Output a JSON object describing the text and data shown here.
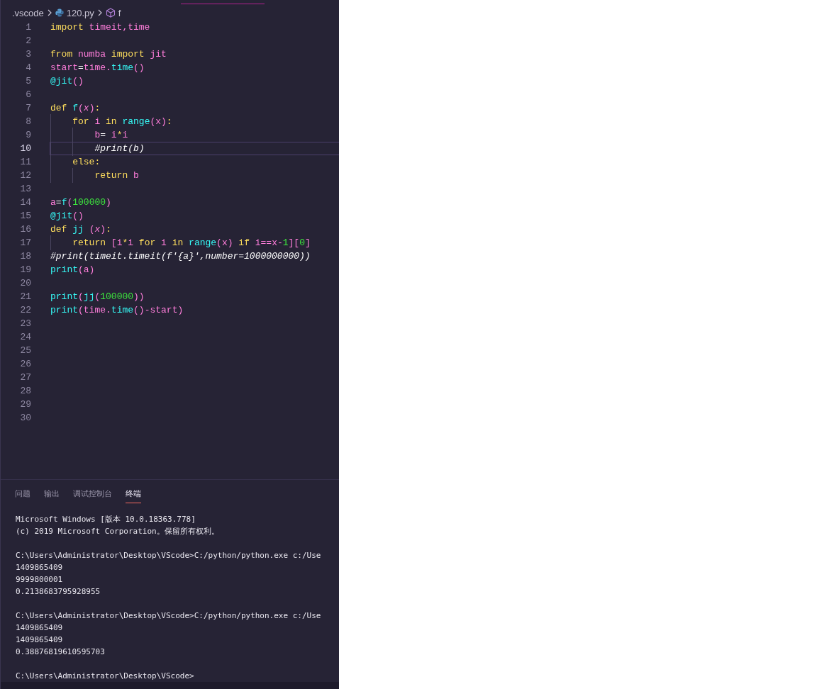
{
  "breadcrumb": [
    {
      "kind": "folder",
      "label": ".vscode"
    },
    {
      "kind": "file",
      "label": "120.py"
    },
    {
      "kind": "symbol",
      "label": "f"
    }
  ],
  "editor": {
    "lines": [
      {
        "number": "1",
        "current": false,
        "tokens": [
          {
            "kind": "kw",
            "text": "import "
          },
          {
            "kind": "var",
            "text": "timeit,time"
          }
        ]
      },
      {
        "number": "2",
        "current": false
      },
      {
        "number": "3",
        "current": false,
        "tokens": [
          {
            "kind": "kw",
            "text": "from "
          },
          {
            "kind": "var",
            "text": "numba "
          },
          {
            "kind": "kw",
            "text": "import "
          },
          {
            "kind": "var",
            "text": "jit"
          }
        ]
      },
      {
        "number": "4",
        "current": false,
        "tokens": [
          {
            "kind": "var",
            "text": "start"
          },
          {
            "kind": "op",
            "text": "="
          },
          {
            "kind": "var",
            "text": "time."
          },
          {
            "kind": "fn",
            "text": "time"
          },
          {
            "kind": "var",
            "text": "()"
          }
        ]
      },
      {
        "number": "5",
        "current": false,
        "tokens": [
          {
            "kind": "fn",
            "text": "@jit"
          },
          {
            "kind": "var",
            "text": "()"
          }
        ]
      },
      {
        "number": "6",
        "current": false
      },
      {
        "number": "7",
        "current": false,
        "tokens": [
          {
            "kind": "kw",
            "text": "def "
          },
          {
            "kind": "fn",
            "text": "f"
          },
          {
            "kind": "var",
            "text": "("
          },
          {
            "kind": "param",
            "text": "x"
          },
          {
            "kind": "var",
            "text": ")"
          },
          {
            "kind": "kw",
            "text": ":"
          }
        ]
      },
      {
        "number": "8",
        "current": false,
        "tokens": [
          {
            "kind": "kw",
            "text": "    for "
          },
          {
            "kind": "var",
            "text": "i "
          },
          {
            "kind": "kw",
            "text": "in "
          },
          {
            "kind": "fn",
            "text": "range"
          },
          {
            "kind": "var",
            "text": "(x)"
          },
          {
            "kind": "kw",
            "text": ":"
          }
        ]
      },
      {
        "number": "9",
        "current": false,
        "tokens": [
          {
            "kind": "var",
            "text": "        b"
          },
          {
            "kind": "op",
            "text": "= "
          },
          {
            "kind": "var",
            "text": "i"
          },
          {
            "kind": "kw",
            "text": "*"
          },
          {
            "kind": "var",
            "text": "i"
          }
        ]
      },
      {
        "number": "10",
        "current": true,
        "tokens": [
          {
            "kind": "cmt",
            "text": "        #print(b)"
          }
        ]
      },
      {
        "number": "11",
        "current": false,
        "tokens": [
          {
            "kind": "kw",
            "text": "    else:"
          }
        ]
      },
      {
        "number": "12",
        "current": false,
        "tokens": [
          {
            "kind": "kw",
            "text": "        return "
          },
          {
            "kind": "var",
            "text": "b"
          }
        ]
      },
      {
        "number": "13",
        "current": false
      },
      {
        "number": "14",
        "current": false,
        "tokens": [
          {
            "kind": "var",
            "text": "a"
          },
          {
            "kind": "op",
            "text": "="
          },
          {
            "kind": "fn",
            "text": "f"
          },
          {
            "kind": "var",
            "text": "("
          },
          {
            "kind": "num",
            "text": "100000"
          },
          {
            "kind": "var",
            "text": ")"
          }
        ]
      },
      {
        "number": "15",
        "current": false,
        "tokens": [
          {
            "kind": "fn",
            "text": "@jit"
          },
          {
            "kind": "var",
            "text": "()"
          }
        ]
      },
      {
        "number": "16",
        "current": false,
        "tokens": [
          {
            "kind": "kw",
            "text": "def "
          },
          {
            "kind": "fn",
            "text": "jj "
          },
          {
            "kind": "var",
            "text": "("
          },
          {
            "kind": "param",
            "text": "x"
          },
          {
            "kind": "var",
            "text": ")"
          },
          {
            "kind": "kw",
            "text": ":"
          }
        ]
      },
      {
        "number": "17",
        "current": false,
        "tokens": [
          {
            "kind": "kw",
            "text": "    return "
          },
          {
            "kind": "var",
            "text": "[i"
          },
          {
            "kind": "kw",
            "text": "*"
          },
          {
            "kind": "var",
            "text": "i "
          },
          {
            "kind": "kw",
            "text": "for "
          },
          {
            "kind": "var",
            "text": "i "
          },
          {
            "kind": "kw",
            "text": "in "
          },
          {
            "kind": "fn",
            "text": "range"
          },
          {
            "kind": "var",
            "text": "(x) "
          },
          {
            "kind": "kw",
            "text": "if "
          },
          {
            "kind": "var",
            "text": "i==x-"
          },
          {
            "kind": "num",
            "text": "1"
          },
          {
            "kind": "var",
            "text": "]["
          },
          {
            "kind": "num",
            "text": "0"
          },
          {
            "kind": "var",
            "text": "]"
          }
        ]
      },
      {
        "number": "18",
        "current": false,
        "tokens": [
          {
            "kind": "cmt",
            "text": "#print(timeit.timeit(f'{a}',number=1000000000))"
          }
        ]
      },
      {
        "number": "19",
        "current": false,
        "tokens": [
          {
            "kind": "fn",
            "text": "print"
          },
          {
            "kind": "var",
            "text": "(a)"
          }
        ]
      },
      {
        "number": "20",
        "current": false
      },
      {
        "number": "21",
        "current": false,
        "tokens": [
          {
            "kind": "fn",
            "text": "print"
          },
          {
            "kind": "var",
            "text": "("
          },
          {
            "kind": "fn",
            "text": "jj"
          },
          {
            "kind": "var",
            "text": "("
          },
          {
            "kind": "num",
            "text": "100000"
          },
          {
            "kind": "var",
            "text": "))"
          }
        ]
      },
      {
        "number": "22",
        "current": false,
        "tokens": [
          {
            "kind": "fn",
            "text": "print"
          },
          {
            "kind": "var",
            "text": "(time."
          },
          {
            "kind": "fn",
            "text": "time"
          },
          {
            "kind": "var",
            "text": "()-start)"
          }
        ]
      },
      {
        "number": "23",
        "current": false
      },
      {
        "number": "24",
        "current": false
      },
      {
        "number": "25",
        "current": false
      },
      {
        "number": "26",
        "current": false
      },
      {
        "number": "27",
        "current": false
      },
      {
        "number": "28",
        "current": false
      },
      {
        "number": "29",
        "current": false
      },
      {
        "number": "30",
        "current": false
      }
    ]
  },
  "panel": {
    "tabs": [
      {
        "label": "问题",
        "selected": false
      },
      {
        "label": "输出",
        "selected": false
      },
      {
        "label": "调试控制台",
        "selected": false
      },
      {
        "label": "终端",
        "selected": true
      }
    ],
    "terminal": [
      [
        "Microsoft Windows [版本 10.0.18363.778]",
        "(c) 2019 Microsoft Corporation。保留所有权利。"
      ],
      [
        "C:\\Users\\Administrator\\Desktop\\VScode>C:/python/python.exe c:/Use",
        "1409865409",
        "9999800001",
        "0.2138683795928955"
      ],
      [
        "C:\\Users\\Administrator\\Desktop\\VScode>C:/python/python.exe c:/Use",
        "1409865409",
        "1409865409",
        "0.38876819610595703"
      ],
      [
        "C:\\Users\\Administrator\\Desktop\\VScode>"
      ]
    ]
  }
}
